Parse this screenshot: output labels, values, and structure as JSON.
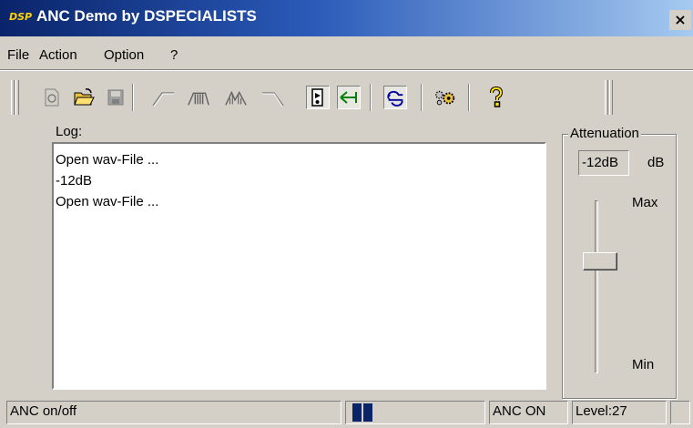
{
  "window": {
    "logo": "DSP",
    "title": "ANC Demo by  DSPECIALISTS",
    "close": "×"
  },
  "menu": {
    "items": [
      "File",
      "Action",
      "Option",
      "?"
    ]
  },
  "toolbar": {
    "buttons": [
      {
        "icon": "new-wav-icon",
        "state": "disabled"
      },
      {
        "icon": "open-folder-icon",
        "state": "enabled"
      },
      {
        "icon": "save-disk-icon",
        "state": "disabled"
      },
      {
        "icon": "highpass-filter-icon",
        "state": "disabled"
      },
      {
        "icon": "bandpass-filter-icon",
        "state": "disabled"
      },
      {
        "icon": "multiband-filter-icon",
        "state": "disabled"
      },
      {
        "icon": "lowpass-filter-icon",
        "state": "disabled"
      },
      {
        "icon": "speaker-icon",
        "state": "pressed"
      },
      {
        "icon": "arrow-left-icon",
        "state": "pressed"
      },
      {
        "icon": "loop-icon",
        "state": "pressed"
      },
      {
        "icon": "settings-gears-icon",
        "state": "enabled"
      },
      {
        "icon": "help-icon",
        "state": "enabled"
      }
    ]
  },
  "log": {
    "label": "Log:",
    "lines": [
      "Open wav-File ...",
      "-12dB",
      "Open wav-File ..."
    ]
  },
  "attenuation": {
    "title": "Attenuation",
    "value": "-12dB",
    "unit": "dB",
    "max_label": "Max",
    "min_label": "Min",
    "slider_level": 0.67
  },
  "status": {
    "hint": "ANC on/off",
    "progress_blocks": 2,
    "anc_state": "ANC ON",
    "level": "Level:27"
  },
  "colors": {
    "title_start": "#0a246a",
    "title_end": "#a6caf0",
    "face": "#d4d0c8",
    "progress": "#0a246a",
    "logo": "#ffd200"
  }
}
